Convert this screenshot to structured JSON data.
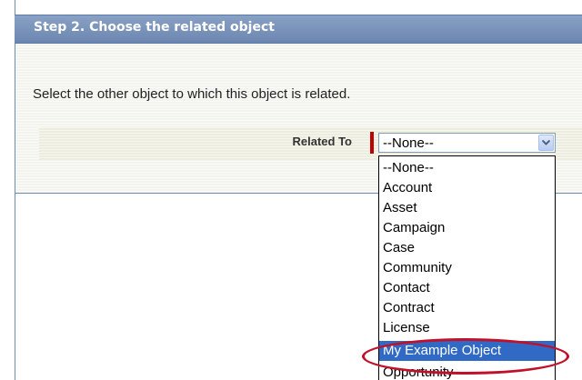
{
  "step": {
    "title": "Step 2. Choose the related object"
  },
  "instruction": "Select the other object to which this object is related.",
  "field": {
    "label": "Related To",
    "required": true,
    "selected_value": "--None--"
  },
  "dropdown": {
    "options": [
      "--None--",
      "Account",
      "Asset",
      "Campaign",
      "Case",
      "Community",
      "Contact",
      "Contract",
      "License",
      "My Example Object",
      "Opportunity"
    ],
    "highlighted_option": "My Example Object"
  },
  "colors": {
    "header": "#7690b9",
    "required_marker": "#c00000",
    "highlight": "#316ac5",
    "annotation_circle": "#c0102a"
  }
}
